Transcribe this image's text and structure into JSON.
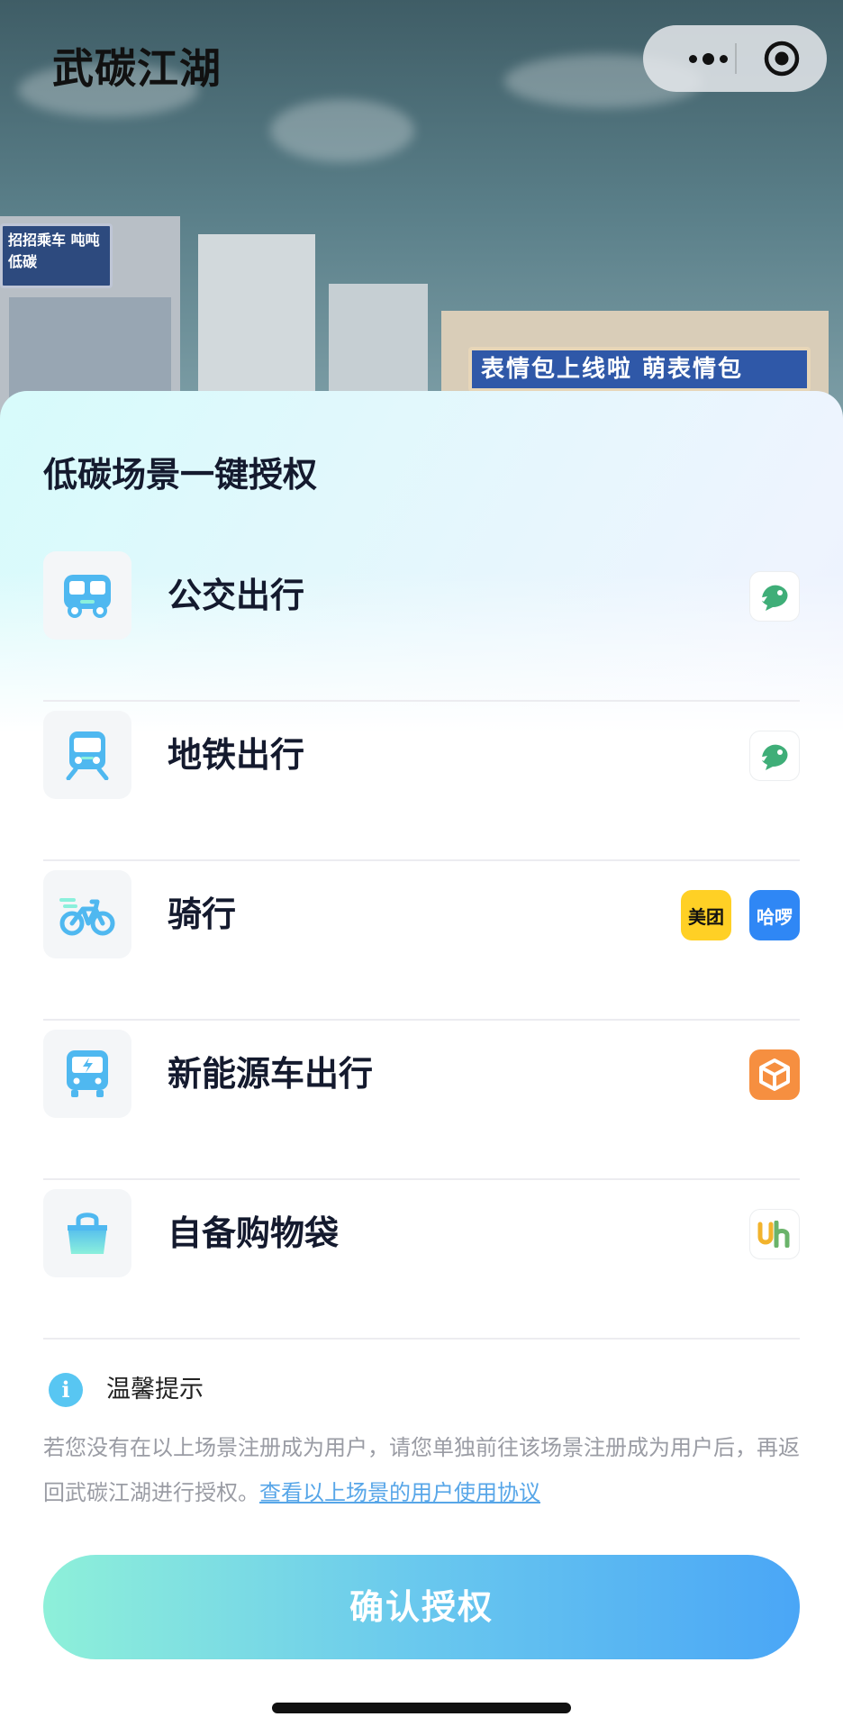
{
  "app": {
    "title": "武碳江湖"
  },
  "background": {
    "sign_left": "招招乘车 吨吨低碳",
    "sign_right": "表情包上线啦 萌表情包"
  },
  "sheet": {
    "title": "低碳场景一键授权",
    "scenes": [
      {
        "label": "公交出行",
        "icon": "bus-icon",
        "partners": [
          {
            "name": "transit-app-logo",
            "text": ""
          }
        ]
      },
      {
        "label": "地铁出行",
        "icon": "metro-icon",
        "partners": [
          {
            "name": "transit-app-logo",
            "text": ""
          }
        ]
      },
      {
        "label": "骑行",
        "icon": "bicycle-icon",
        "partners": [
          {
            "name": "meituan-logo",
            "text": "美团"
          },
          {
            "name": "hellobike-logo",
            "text": "哈啰"
          }
        ]
      },
      {
        "label": "新能源车出行",
        "icon": "ev-bus-icon",
        "partners": [
          {
            "name": "cube-logo",
            "text": ""
          }
        ]
      },
      {
        "label": "自备购物袋",
        "icon": "shopping-bag-icon",
        "partners": [
          {
            "name": "uh-logo",
            "text": "Uh"
          }
        ]
      }
    ],
    "tip": {
      "title": "温馨提示",
      "text": "若您没有在以上场景注册成为用户，请您单独前往该场景注册成为用户后，再返回武碳江湖进行授权。",
      "link": "查看以上场景的用户使用协议"
    },
    "confirm_label": "确认授权"
  },
  "colors": {
    "accent_start": "#8ef0d9",
    "accent_end": "#4aa6f6",
    "icon_blue": "#4fb8f0",
    "link": "#57a6e8",
    "meituan": "#ffd025",
    "hellobike": "#2f87f5",
    "cube": "#f68f40"
  }
}
